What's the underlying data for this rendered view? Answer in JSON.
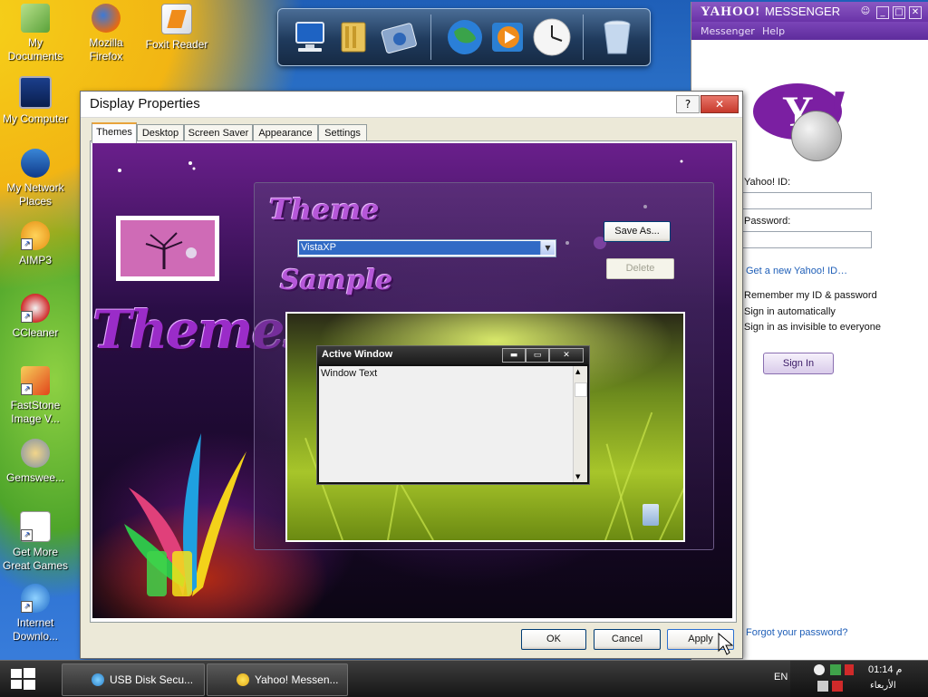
{
  "desktop": {
    "icons": [
      {
        "label": "My\nDocuments"
      },
      {
        "label": "Mozilla\nFirefox"
      },
      {
        "label": "Foxit Reader"
      },
      {
        "label": "My Computer"
      },
      {
        "label": "My Network\nPlaces"
      },
      {
        "label": "AIMP3"
      },
      {
        "label": "CCleaner"
      },
      {
        "label": "FastStone\nImage V..."
      },
      {
        "label": "Gemswee..."
      },
      {
        "label": "Get More\nGreat Games"
      },
      {
        "label": "Internet\nDownlo..."
      }
    ]
  },
  "dock": {
    "items": [
      "computer-icon",
      "folder-icon",
      "control-panel-icon",
      "globe-icon",
      "media-player-icon",
      "clock-icon",
      "recycle-bin-icon"
    ]
  },
  "yahoo": {
    "title_logo": "YAHOO!",
    "title_text": "MESSENGER",
    "menu": [
      "Messenger",
      "Help"
    ],
    "id_label": "Yahoo! ID:",
    "password_label": "Password:",
    "get_new_id": "Get a new Yahoo! ID…",
    "remember": "Remember my ID & password",
    "sign_in_auto": "Sign in automatically",
    "sign_in_invisible": "Sign in as invisible to everyone",
    "sign_in_button": "Sign In",
    "forgot": "Forgot your password?"
  },
  "display_properties": {
    "title": "Display Properties",
    "help": "?",
    "close": "✕",
    "tabs": [
      "Themes",
      "Desktop",
      "Screen Saver",
      "Appearance",
      "Settings"
    ],
    "active_tab": "Themes",
    "theme_heading": "Theme",
    "theme_value": "VistaXP",
    "save_as": "Save As...",
    "delete": "Delete",
    "sample_heading": "Sample",
    "art_big_text": "Themes",
    "active_window_title": "Active Window",
    "window_text": "Window Text",
    "ok": "OK",
    "cancel": "Cancel",
    "apply": "Apply"
  },
  "taskbar": {
    "buttons": [
      {
        "label": "USB Disk Secu..."
      },
      {
        "label": "Yahoo! Messen..."
      }
    ],
    "language": "EN",
    "time": "01:14 م",
    "day": "الأربعاء"
  }
}
